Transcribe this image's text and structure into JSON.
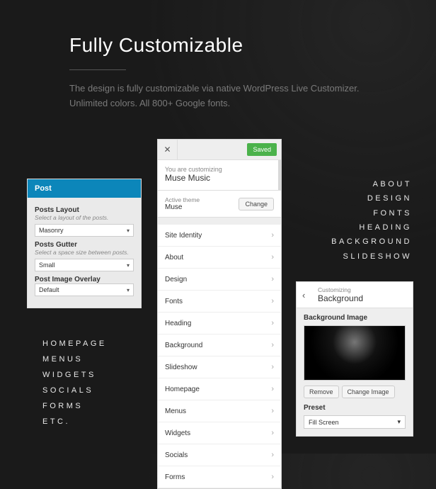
{
  "hero": {
    "title": "Fully Customizable",
    "description": "The design is fully customizable via native WordPress Live Customizer. Unlimited colors. All 800+ Google fonts."
  },
  "post_panel": {
    "header": "Post",
    "fields": [
      {
        "label": "Posts Layout",
        "hint": "Select a layout of the posts.",
        "value": "Masonry"
      },
      {
        "label": "Posts Gutter",
        "hint": "Select a space size between posts.",
        "value": "Small"
      },
      {
        "label": "Post Image Overlay",
        "hint": "",
        "value": "Default"
      }
    ]
  },
  "left_list": [
    "HOMEPAGE",
    "MENUS",
    "WIDGETS",
    "SOCIALS",
    "FORMS",
    "ETC."
  ],
  "right_list": [
    "ABOUT",
    "DESIGN",
    "FONTS",
    "HEADING",
    "BACKGROUND",
    "SLIDESHOW"
  ],
  "customizer": {
    "saved_label": "Saved",
    "sub_small": "You are customizing",
    "sub_title": "Muse Music",
    "theme_small": "Active theme",
    "theme_name": "Muse",
    "change_label": "Change",
    "rows": [
      "Site Identity",
      "About",
      "Design",
      "Fonts",
      "Heading",
      "Background",
      "Slideshow",
      "Homepage",
      "Menus",
      "Widgets",
      "Socials",
      "Forms"
    ]
  },
  "bg_panel": {
    "breadcrumb_small": "Customizing",
    "breadcrumb_title": "Background",
    "label": "Background Image",
    "remove_label": "Remove",
    "change_label": "Change Image",
    "preset_label": "Preset",
    "preset_value": "Fill Screen"
  }
}
